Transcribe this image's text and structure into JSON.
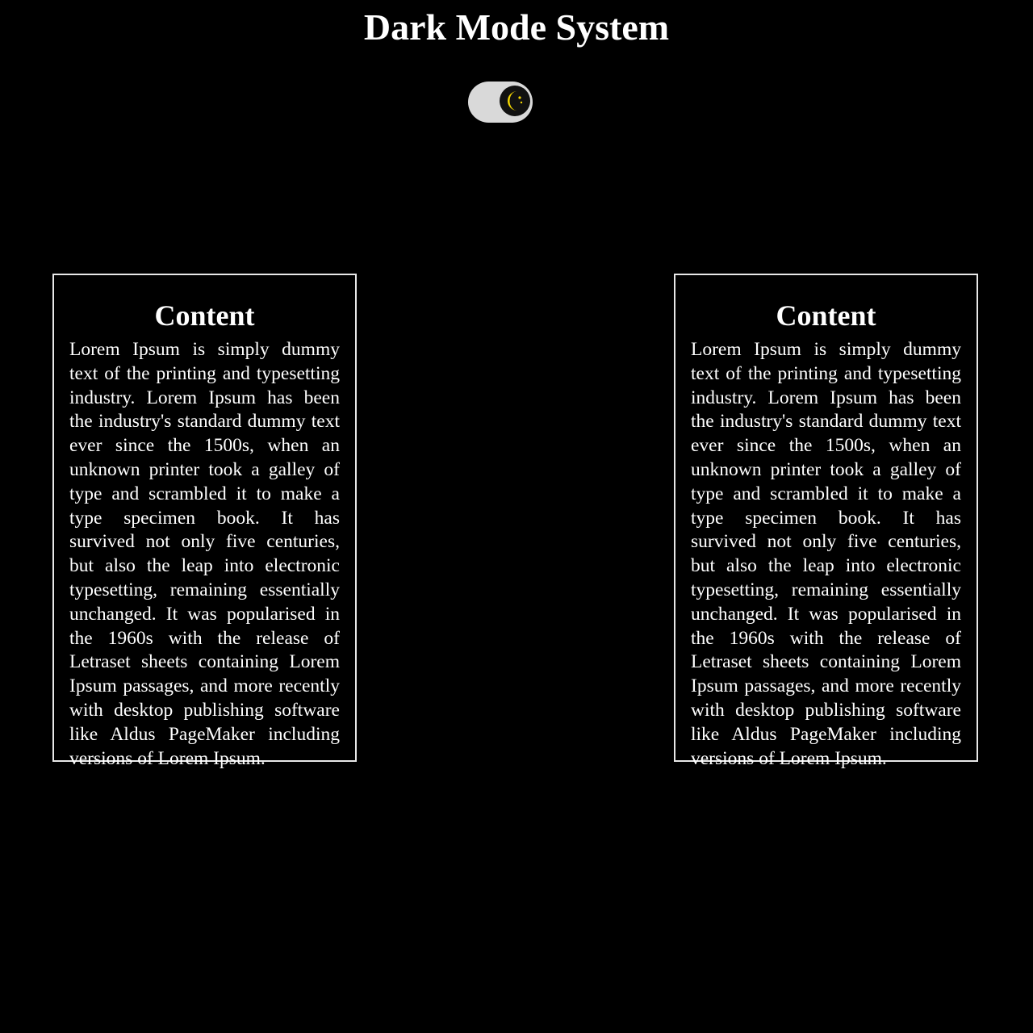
{
  "header": {
    "title": "Dark Mode System"
  },
  "theme_toggle": {
    "state": "dark",
    "icon": "moon-icon",
    "track_color": "#d9d9d9",
    "knob_color": "#111111",
    "icon_color": "#f5d800"
  },
  "cards": [
    {
      "title": "Content",
      "text": "Lorem Ipsum is simply dummy text of the printing and typesetting industry. Lorem Ipsum has been the industry's standard dummy text ever since the 1500s, when an unknown printer took a galley of type and scrambled it to make a type specimen book. It has survived not only five centuries, but also the leap into electronic typesetting, remaining essentially unchanged. It was popularised in the 1960s with the release of Letraset sheets containing Lorem Ipsum passages, and more recently with desktop publishing software like Aldus PageMaker including versions of Lorem Ipsum."
    },
    {
      "title": "Content",
      "text": "Lorem Ipsum is simply dummy text of the printing and typesetting industry. Lorem Ipsum has been the industry's standard dummy text ever since the 1500s, when an unknown printer took a galley of type and scrambled it to make a type specimen book. It has survived not only five centuries, but also the leap into electronic typesetting, remaining essentially unchanged. It was popularised in the 1960s with the release of Letraset sheets containing Lorem Ipsum passages, and more recently with desktop publishing software like Aldus PageMaker including versions of Lorem Ipsum."
    }
  ],
  "colors": {
    "background": "#000000",
    "text": "#ffffff",
    "card_border": "#e8e8e8"
  }
}
